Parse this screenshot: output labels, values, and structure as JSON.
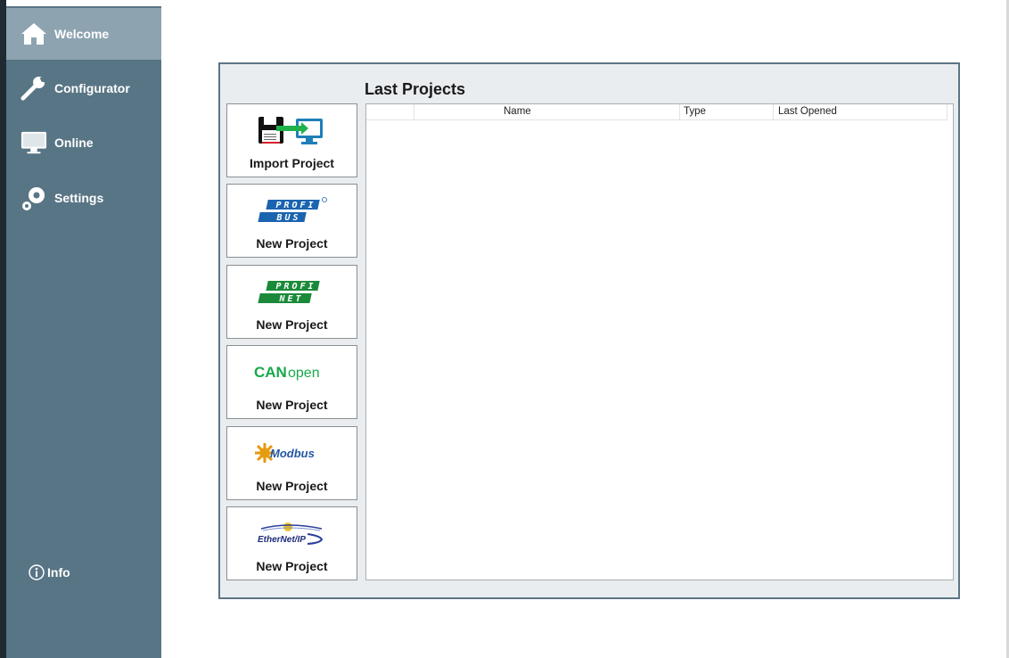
{
  "sidebar": {
    "items": [
      {
        "label": "Welcome",
        "icon": "home-icon",
        "active": true
      },
      {
        "label": "Configurator",
        "icon": "wrench-icon",
        "active": false
      },
      {
        "label": "Online",
        "icon": "monitor-icon",
        "active": false
      },
      {
        "label": "Settings",
        "icon": "gears-icon",
        "active": false
      }
    ],
    "info_label": "Info",
    "info_icon": "info-icon"
  },
  "main": {
    "title": "Last Projects",
    "tiles": [
      {
        "label": "Import Project",
        "icon": "import-project-icon"
      },
      {
        "label": "New Project",
        "logo": "profibus-logo",
        "logo_text_top": "PROFI",
        "logo_text_bottom": "BUS"
      },
      {
        "label": "New Project",
        "logo": "profinet-logo",
        "logo_text_top": "PROFI",
        "logo_text_bottom": "NET"
      },
      {
        "label": "New Project",
        "logo": "canopen-logo",
        "logo_text_bold": "CAN",
        "logo_text_light": "open"
      },
      {
        "label": "New Project",
        "logo": "modbus-logo",
        "logo_text": "Modbus"
      },
      {
        "label": "New Project",
        "logo": "ethernet-ip-logo",
        "logo_text": "EtherNet/IP"
      }
    ],
    "table": {
      "columns": [
        "",
        "Name",
        "Type",
        "Last Opened"
      ],
      "rows": []
    }
  },
  "colors": {
    "sidebar": "#587585",
    "sidebar_active": "#8da3b0",
    "panel_bg": "#eaedef",
    "panel_border": "#5c7585",
    "profibus_blue": "#1b64b0",
    "profinet_green": "#1a8a3a",
    "canopen_green": "#18a84a"
  }
}
